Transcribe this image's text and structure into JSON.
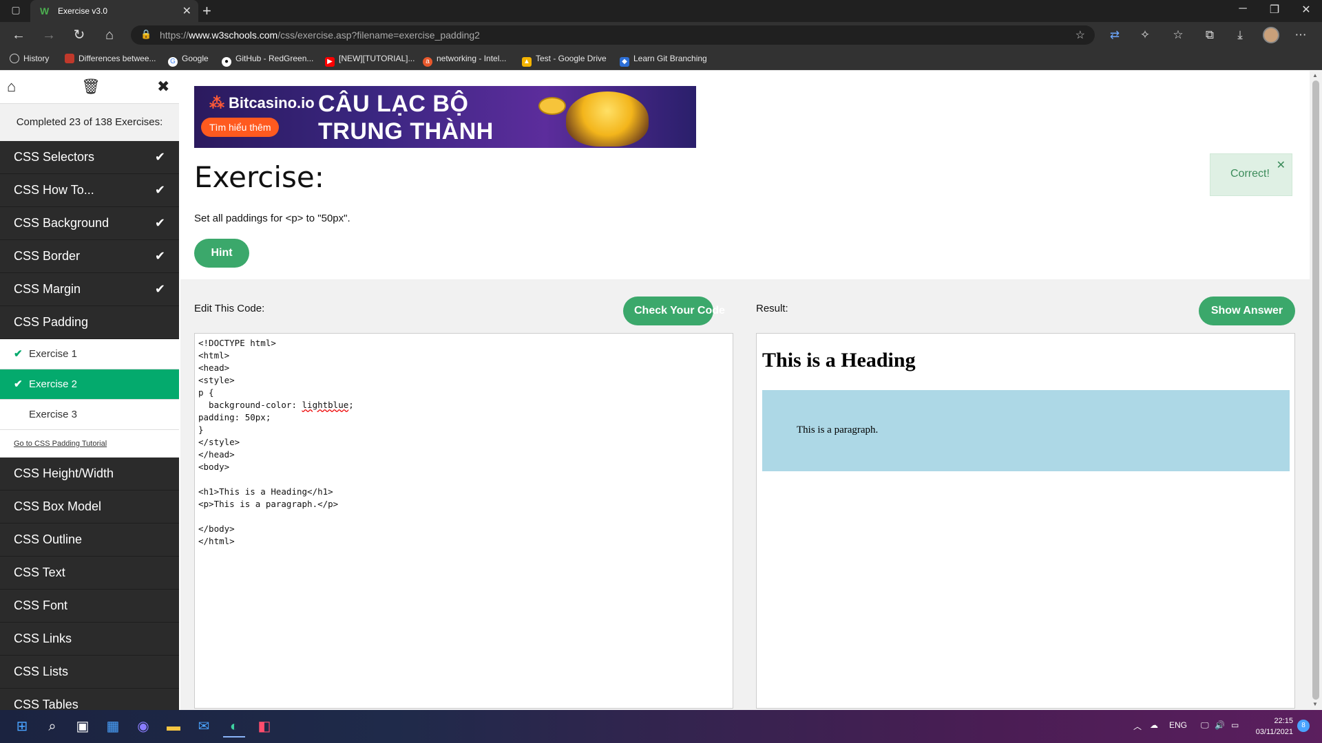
{
  "browser": {
    "tab_title": "Exercise v3.0",
    "url_host": "www.w3schools.com",
    "url_prefix": "https://",
    "url_path": "/css/exercise.asp?filename=exercise_padding2",
    "bookmarks": [
      {
        "label": "History",
        "icon": "history-icon",
        "color": "#555"
      },
      {
        "label": "Differences betwee...",
        "icon": "bookmark-icon",
        "color": "#c0392b"
      },
      {
        "label": "Google",
        "icon": "google-icon",
        "color": "#4285f4"
      },
      {
        "label": "GitHub - RedGreen...",
        "icon": "github-icon",
        "color": "#111"
      },
      {
        "label": "[NEW][TUTORIAL]...",
        "icon": "youtube-icon",
        "color": "#ff0000"
      },
      {
        "label": "networking - Intel...",
        "icon": "ask-icon",
        "color": "#e8582c"
      },
      {
        "label": "Test - Google Drive",
        "icon": "drive-icon",
        "color": "#f4b400"
      },
      {
        "label": "Learn Git Branching",
        "icon": "git-icon",
        "color": "#2d6fd6"
      }
    ]
  },
  "sidebar": {
    "progress": "Completed 23 of 138 Exercises:",
    "items": [
      {
        "label": "CSS Selectors",
        "done": true
      },
      {
        "label": "CSS How To...",
        "done": true
      },
      {
        "label": "CSS Background",
        "done": true
      },
      {
        "label": "CSS Border",
        "done": true
      },
      {
        "label": "CSS Margin",
        "done": true
      },
      {
        "label": "CSS Padding",
        "done": false
      }
    ],
    "sub_items": [
      {
        "label": "Exercise 1",
        "done": true,
        "active": false
      },
      {
        "label": "Exercise 2",
        "done": true,
        "active": true
      },
      {
        "label": "Exercise 3",
        "done": false,
        "active": false
      }
    ],
    "tutorial_link": "Go to CSS Padding Tutorial",
    "items_after": [
      {
        "label": "CSS Height/Width"
      },
      {
        "label": "CSS Box Model"
      },
      {
        "label": "CSS Outline"
      },
      {
        "label": "CSS Text"
      },
      {
        "label": "CSS Font"
      },
      {
        "label": "CSS Links"
      },
      {
        "label": "CSS Lists"
      },
      {
        "label": "CSS Tables"
      }
    ]
  },
  "ad": {
    "brand": "Bitcasino.io",
    "cta": "Tìm hiểu thêm",
    "headline_line1": "CÂU LẠC BỘ",
    "headline_line2": "TRUNG THÀNH"
  },
  "exercise": {
    "title": "Exercise:",
    "instruction": "Set all paddings for <p> to \"50px\".",
    "hint_label": "Hint",
    "toast": "Correct!"
  },
  "editor": {
    "label": "Edit This Code:",
    "check_label": "Check Your Code",
    "code_before": "<!DOCTYPE html>\n<html>\n<head>\n<style>\np {\n  background-color: ",
    "code_squiggle": "lightblue",
    "code_after": ";\npadding: 50px;\n}\n</style>\n</head>\n<body>\n\n<h1>This is a Heading</h1>\n<p>This is a paragraph.</p>\n\n</body>\n</html>"
  },
  "result": {
    "label": "Result:",
    "answer_label": "Show Answer",
    "heading": "This is a Heading",
    "paragraph": "This is a paragraph."
  },
  "taskbar": {
    "lang": "ENG",
    "time": "22:15",
    "date": "03/11/2021",
    "notifications": "8"
  },
  "colors": {
    "accent": "#04aa6d",
    "sidebar_bg": "#2b2b2b",
    "result_box": "lightblue"
  }
}
